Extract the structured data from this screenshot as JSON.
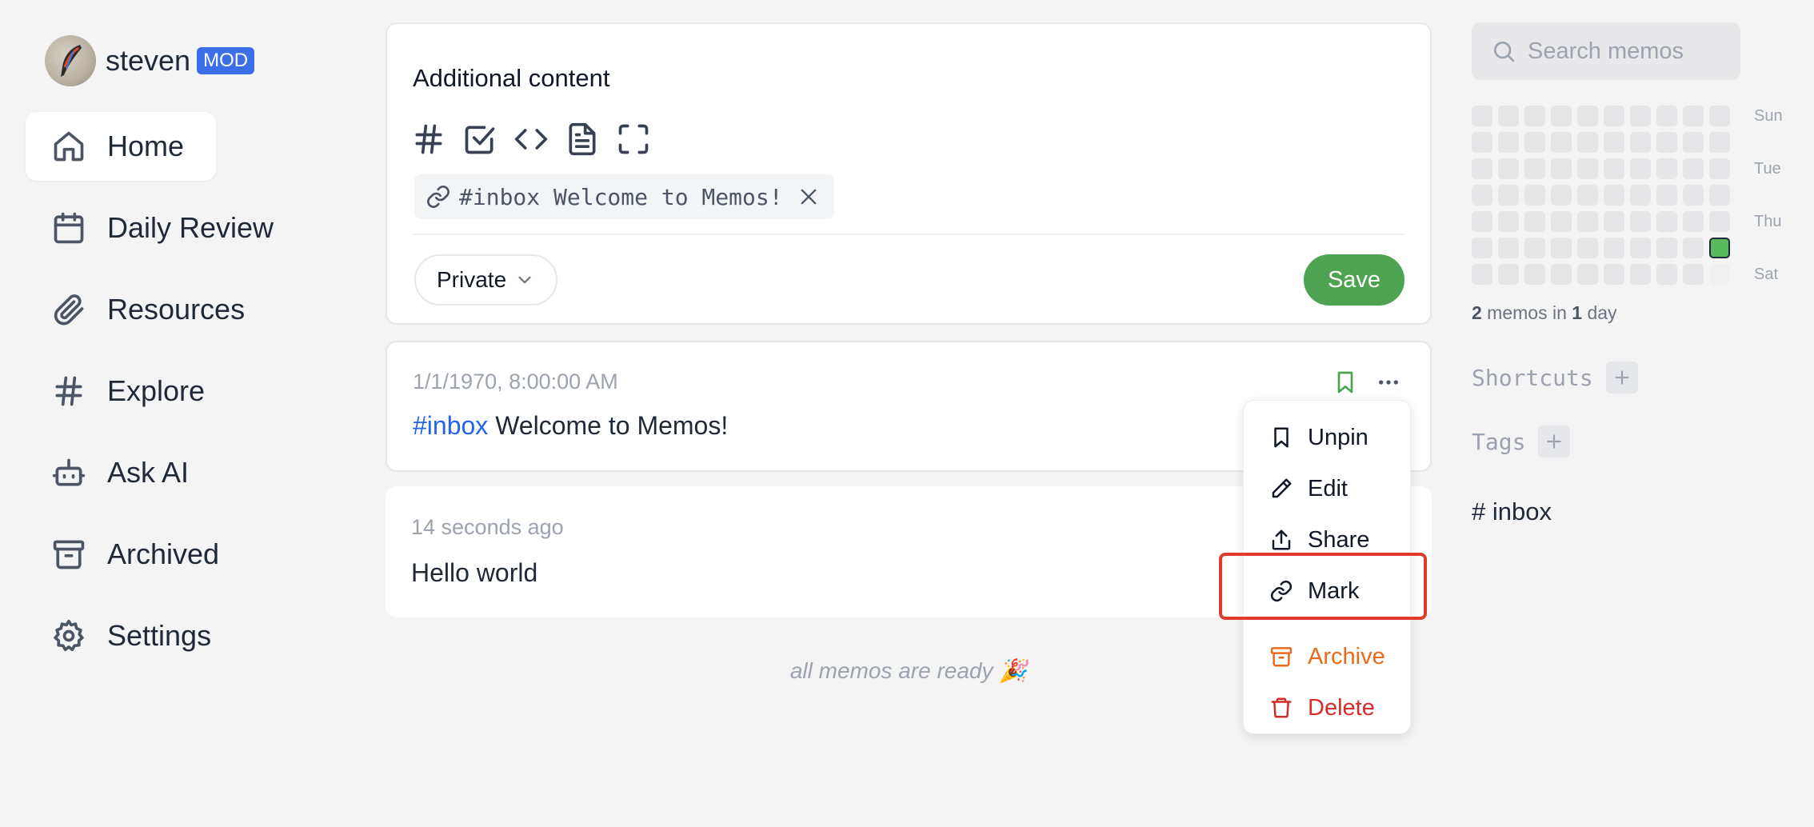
{
  "user": {
    "name": "steven",
    "role_badge": "MOD"
  },
  "nav": [
    {
      "label": "Home",
      "icon": "home-icon",
      "active": true
    },
    {
      "label": "Daily Review",
      "icon": "calendar-icon"
    },
    {
      "label": "Resources",
      "icon": "paperclip-icon"
    },
    {
      "label": "Explore",
      "icon": "hash-icon"
    },
    {
      "label": "Ask AI",
      "icon": "bot-icon"
    },
    {
      "label": "Archived",
      "icon": "archive-icon"
    },
    {
      "label": "Settings",
      "icon": "gear-icon"
    }
  ],
  "editor": {
    "content": "Additional content",
    "toolbar": [
      "hash-icon",
      "checkbox-icon",
      "code-icon",
      "file-icon",
      "fullscreen-icon"
    ],
    "relation_chip": "#inbox Welcome to Memos!",
    "visibility": "Private",
    "save_label": "Save"
  },
  "memos": [
    {
      "time": "1/1/1970, 8:00:00 AM",
      "tag": "#inbox",
      "text": "Welcome to Memos!",
      "pinned": true
    },
    {
      "time": "14 seconds ago",
      "text": "Hello world"
    }
  ],
  "end_note": "all memos are ready 🎉",
  "menu": {
    "items": [
      {
        "label": "Unpin",
        "icon": "bookmark-icon"
      },
      {
        "label": "Edit",
        "icon": "pencil-icon"
      },
      {
        "label": "Share",
        "icon": "share-icon"
      },
      {
        "label": "Mark",
        "icon": "link-icon",
        "highlighted": true
      },
      {
        "label": "Archive",
        "icon": "archive-icon",
        "color": "#ea6a1b"
      },
      {
        "label": "Delete",
        "icon": "trash-icon",
        "color": "#d62d28"
      }
    ]
  },
  "search": {
    "placeholder": "Search memos"
  },
  "heatmap": {
    "days": [
      "Sun",
      "Tue",
      "Thu",
      "Sat"
    ],
    "stats": {
      "memos": "2",
      "mid": " memos in ",
      "days": "1",
      "suffix": " day"
    },
    "active_color": "#58b95a"
  },
  "shortcuts": {
    "title": "Shortcuts"
  },
  "tags": {
    "title": "Tags",
    "items": [
      "inbox"
    ]
  },
  "colors": {
    "save": "#4ea352",
    "tag_link": "#2563eb",
    "mod_badge": "#3b6ee8",
    "highlight": "#e03b28"
  }
}
